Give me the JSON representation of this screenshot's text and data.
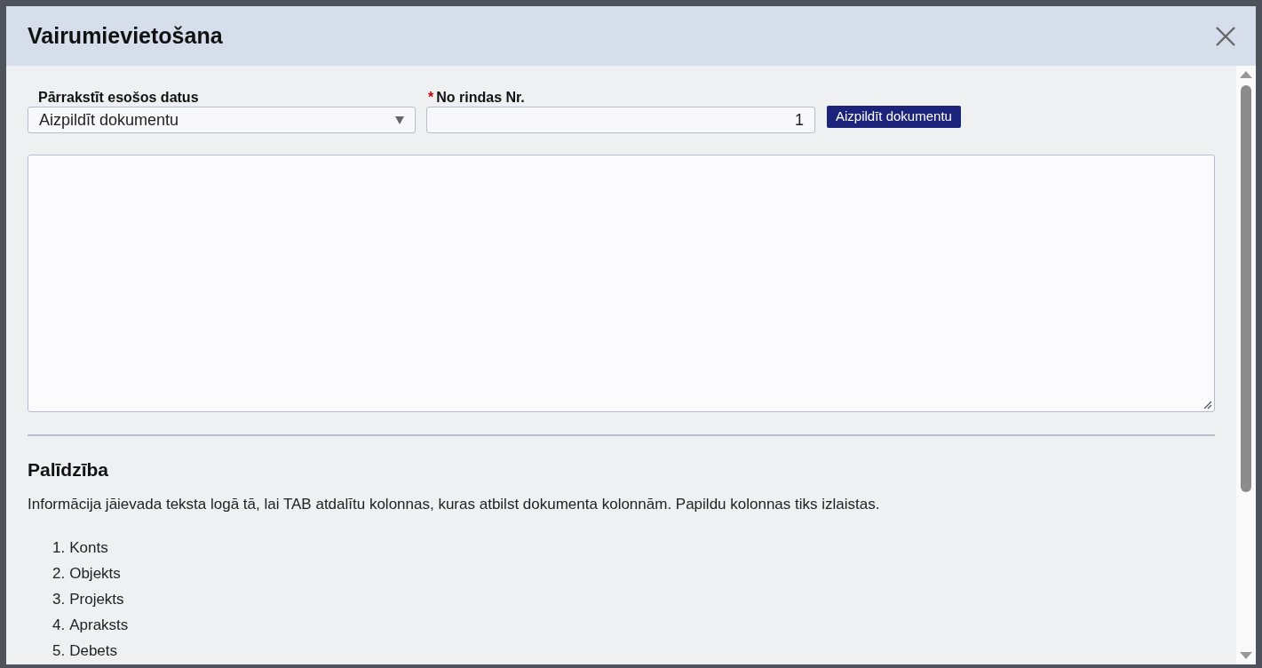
{
  "dialog": {
    "title": "Vairumievietošana"
  },
  "overwrite_field": {
    "label": "Pārrakstīt esošos datus",
    "value": "Aizpildīt dokumentu"
  },
  "row_field": {
    "label": "No rindas Nr.",
    "required": true,
    "required_mark": "*",
    "value": "1"
  },
  "fill_button": "Aizpildīt dokumentu",
  "help": {
    "heading": "Palīdzība",
    "text": "Informācija jāievada teksta logā tā, lai TAB atdalītu kolonnas, kuras atbilst dokumenta kolonnām. Papildu kolonnas tiks izlaistas.",
    "items": [
      {
        "number": "1.",
        "label": "Konts"
      },
      {
        "number": "2.",
        "label": "Objekts"
      },
      {
        "number": "3.",
        "label": "Projekts"
      },
      {
        "number": "4.",
        "label": "Apraksts"
      },
      {
        "number": "5.",
        "label": "Debets"
      }
    ]
  }
}
